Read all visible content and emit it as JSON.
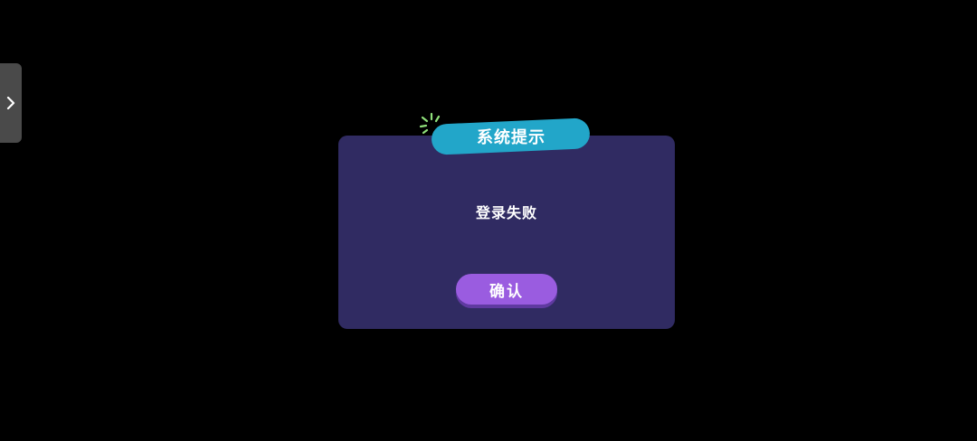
{
  "side_tab": {
    "icon": "chevron-right-icon"
  },
  "dialog": {
    "title": "系统提示",
    "message": "登录失败",
    "confirm_label": "确认"
  },
  "colors": {
    "background": "#000000",
    "dialog": "#302b62",
    "title_ribbon": "#22a6c9",
    "button": "#9a5ce0",
    "button_shadow": "#5f3aa0",
    "sparkle": "#8fe07a",
    "side_tab": "#4a4a4a"
  }
}
